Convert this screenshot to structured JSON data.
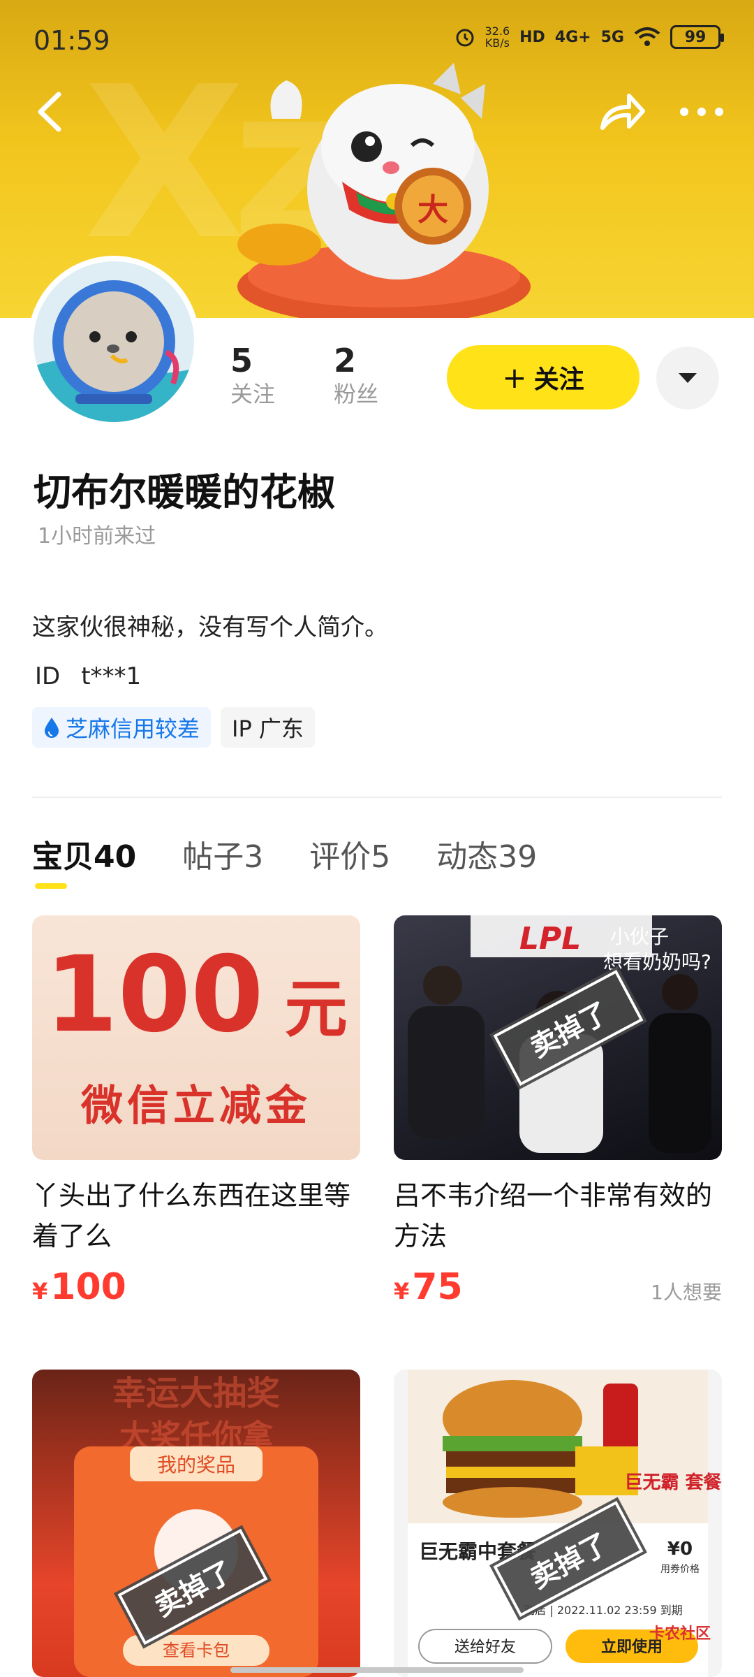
{
  "status_bar": {
    "time": "01:59",
    "speed_value": "32.6",
    "speed_unit": "KB/s",
    "hd": "HD",
    "net1": "4G+",
    "net2": "5G",
    "battery": "99"
  },
  "profile": {
    "following_count": "5",
    "following_label": "关注",
    "followers_count": "2",
    "followers_label": "粉丝",
    "follow_button_plus": "+",
    "follow_button_label": "关注",
    "username": "切布尔暖暖的花椒",
    "last_seen": "1小时前来过",
    "bio": "这家伙很神秘，没有写个人简介。",
    "id_label": "ID",
    "id_value": "t***1",
    "tags": {
      "credit": "芝麻信用较差",
      "ip": "IP 广东"
    }
  },
  "tabs": [
    {
      "label": "宝贝",
      "count": "40"
    },
    {
      "label": "帖子",
      "count": "3"
    },
    {
      "label": "评价",
      "count": "5"
    },
    {
      "label": "动态",
      "count": "39"
    }
  ],
  "items": [
    {
      "image_text_big": "100",
      "image_text_unit": "元",
      "image_text_sub": "微信立减金",
      "title": "丫头出了什么东西在这里等着了么",
      "price_symbol": "¥",
      "price": "100",
      "wants": ""
    },
    {
      "image_text_logo": "LPL",
      "image_text_caption_1": "小伙子",
      "image_text_caption_2": "想看奶奶吗?",
      "sold_label": "卖掉了",
      "title": "吕不韦介绍一个非常有效的方法",
      "price_symbol": "¥",
      "price": "75",
      "wants": "1人想要"
    },
    {
      "image_text_top": "幸运大抽奖",
      "image_text_top2": "大奖任你拿",
      "image_text_card": "我的奖品",
      "image_text_btn": "查看卡包",
      "sold_label": "卖掉了"
    },
    {
      "image_text_badge": "巨无霸 套餐",
      "image_text_title": "巨无霸中套餐",
      "image_text_price": "¥0",
      "image_text_price_label": "用券价格",
      "image_text_expiry": "到店 | 2022.11.02 23:59 到期",
      "image_text_gift": "送给好友",
      "image_text_use": "立即使用",
      "image_text_brand": "卡农社区",
      "sold_label": "卖掉了"
    }
  ],
  "colors": {
    "accent_yellow": "#ffe218",
    "price_red": "#ff3b2f",
    "credit_blue": "#1677e8"
  }
}
